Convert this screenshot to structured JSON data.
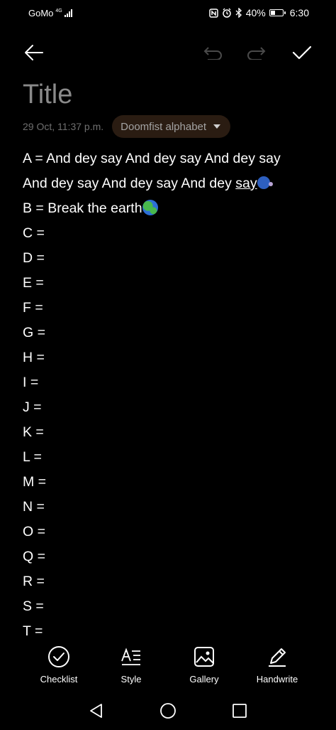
{
  "status": {
    "carrier": "GoMo",
    "network": "4G",
    "battery": "40%",
    "battery_level": 0.4,
    "time": "6:30"
  },
  "toolbar": {
    "back_icon": "arrow-left-icon",
    "undo_icon": "undo-icon",
    "redo_icon": "redo-icon",
    "save_icon": "check-icon"
  },
  "note": {
    "title_placeholder": "Title",
    "date": "29 Oct, 11:37 p.m.",
    "category": "Doomfist alphabet",
    "lines": [
      {
        "text": "A = And dey say And dey say And dey say"
      },
      {
        "text": "And dey say And dey say And dey ",
        "underlined": "say"
      },
      {
        "text": "B = Break the earth"
      },
      {
        "text": "C ="
      },
      {
        "text": "D ="
      },
      {
        "text": "E ="
      },
      {
        "text": "F ="
      },
      {
        "text": "G ="
      },
      {
        "text": "H ="
      },
      {
        "text": "I ="
      },
      {
        "text": "J ="
      },
      {
        "text": "K ="
      },
      {
        "text": "L ="
      },
      {
        "text": "M ="
      },
      {
        "text": "N ="
      },
      {
        "text": "O ="
      },
      {
        "text": "Q ="
      },
      {
        "text": "R ="
      },
      {
        "text": "S ="
      },
      {
        "text": "T ="
      }
    ]
  },
  "tools": [
    {
      "label": "Checklist",
      "icon": "checklist-icon"
    },
    {
      "label": "Style",
      "icon": "text-style-icon"
    },
    {
      "label": "Gallery",
      "icon": "gallery-icon"
    },
    {
      "label": "Handwrite",
      "icon": "pen-icon"
    }
  ],
  "navbar": {
    "back_icon": "nav-back-icon",
    "home_icon": "nav-home-icon",
    "recents_icon": "nav-recents-icon"
  }
}
